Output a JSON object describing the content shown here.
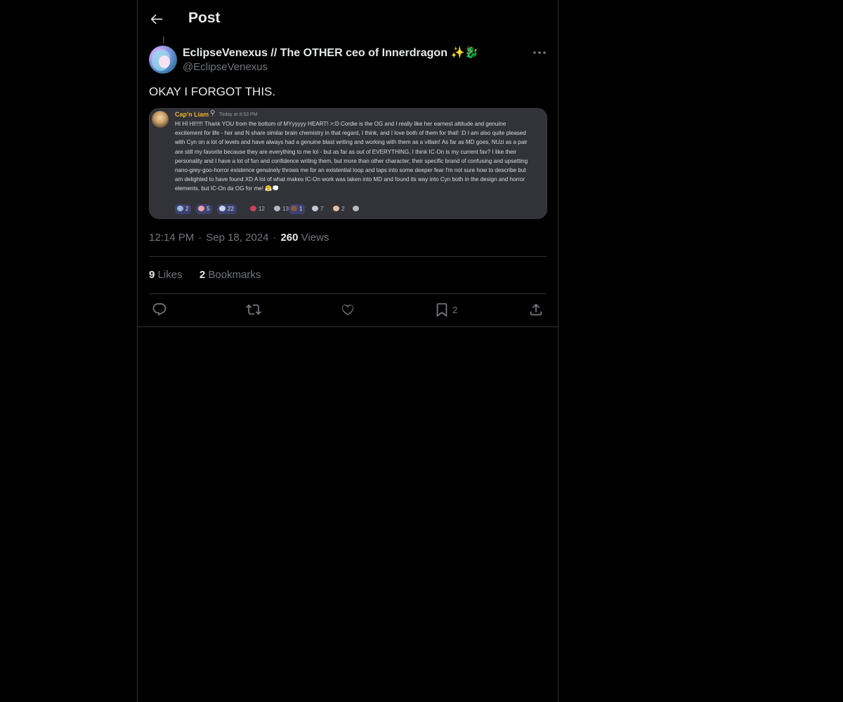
{
  "header": {
    "title": "Post"
  },
  "author": {
    "display_name": "EclipseVenexus // The OTHER ceo of Innerdragon",
    "name_emojis": [
      "✨",
      "🐉"
    ],
    "handle": "@EclipseVenexus"
  },
  "tweet": {
    "text": "OKAY I FORGOT THIS."
  },
  "embedded_message": {
    "username": "Cap'n Liam",
    "timestamp": "Today at 8:53 PM",
    "body": "HI HI HI!!!!! Thank YOU from the bottom of MYyyyyy HEART! >:D Cordie is the OG and I really like her earnest attitude and genuine excitement for life - her and N share similar brain chemistry in that regard, I think, and I love both of them for that! :D I am also quite pleased with Cyn on a lot of levels and have always had a genuine blast writing and working with them as a villain! As far as MD goes, NUzi as a pair are still my favorite because they are everything to me lol - but as far as out of EVERYTHING, I think IC-On is my current fav? I like their personality and I have a lot of fun and confidence writing them, but more than other character, their specific brand of confusing and upsetting nano-grey-goo-horror existence genuinely throws me for an existential loop and taps into some deeper fear I'm not sure how to describe but am delighted to have found XD A lot of what makes IC-On work was taken into MD and found its way into Cyn both in the design and horror elements, but IC-On da OG for me! 😤💭",
    "reactions": [
      {
        "count": "2",
        "active": true,
        "color": "#9fb6d8"
      },
      {
        "count": "5",
        "active": true,
        "color": "#e8a0a8"
      },
      {
        "count": "22",
        "active": true,
        "color": "#c8d4e8"
      },
      {
        "count": "12",
        "active": false,
        "color": "#d0405a"
      },
      {
        "count": "13",
        "active": false,
        "color": "#b0b8c8"
      },
      {
        "count": "1",
        "active": true,
        "color": "#8a5a3c"
      },
      {
        "count": "7",
        "active": false,
        "color": "#c0c8d0"
      },
      {
        "count": "2",
        "active": false,
        "color": "#e0c0a0"
      },
      {
        "count": "",
        "active": false,
        "color": "#b5bac1"
      }
    ]
  },
  "meta": {
    "time": "12:14 PM",
    "separator": "·",
    "date": "Sep 18, 2024",
    "views_count": "260",
    "views_label": "Views"
  },
  "stats": {
    "likes_count": "9",
    "likes_label": "Likes",
    "bookmarks_count": "2",
    "bookmarks_label": "Bookmarks"
  },
  "actions": {
    "bookmark_count": "2"
  },
  "icons": [
    "back-arrow-icon",
    "more-icon",
    "reply-icon",
    "repost-icon",
    "like-icon",
    "bookmark-icon",
    "share-icon"
  ]
}
